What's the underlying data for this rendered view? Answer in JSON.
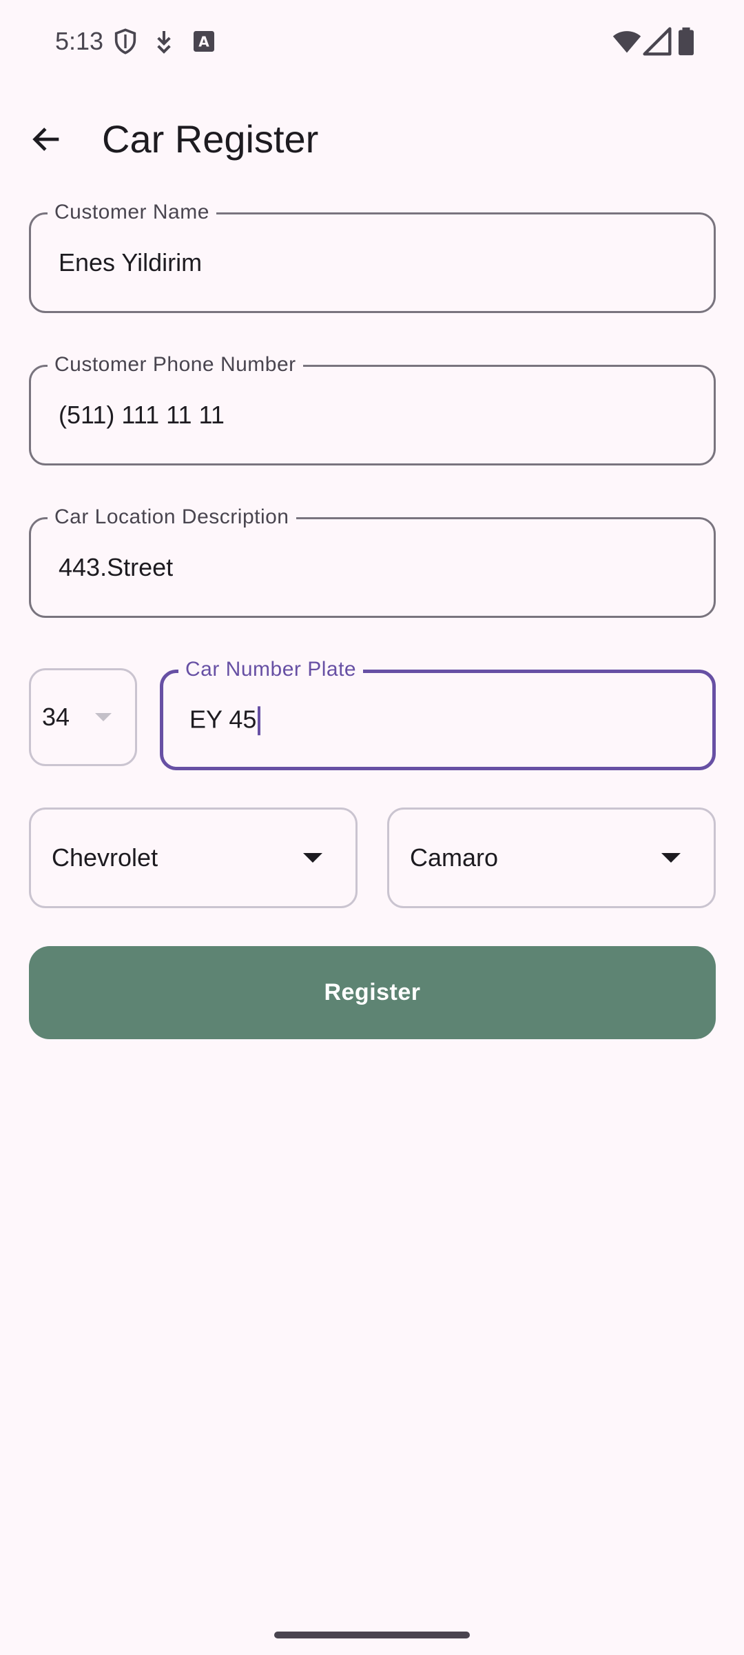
{
  "status_bar": {
    "time": "5:13",
    "icons_left": [
      "shield-icon",
      "download-icon",
      "text-a-icon"
    ],
    "icons_right": [
      "wifi-icon",
      "cellular-signal-icon",
      "battery-icon"
    ]
  },
  "app_bar": {
    "back_icon": "arrow-back-icon",
    "title": "Car Register"
  },
  "form": {
    "customer_name": {
      "label": "Customer Name",
      "value": "Enes Yildirim"
    },
    "customer_phone": {
      "label": "Customer Phone Number",
      "value": "(511) 111 11 11"
    },
    "car_location": {
      "label": "Car Location Description",
      "value": "443.Street"
    },
    "plate_region": {
      "value": "34"
    },
    "car_plate": {
      "label": "Car Number Plate",
      "value": "EY 45"
    },
    "brand": {
      "value": "Chevrolet"
    },
    "model": {
      "value": "Camaro"
    },
    "register_label": "Register"
  },
  "colors": {
    "background": "#FEF7FB",
    "primary": "#6750A4",
    "outline": "#79747E",
    "button": "#5E8473"
  }
}
